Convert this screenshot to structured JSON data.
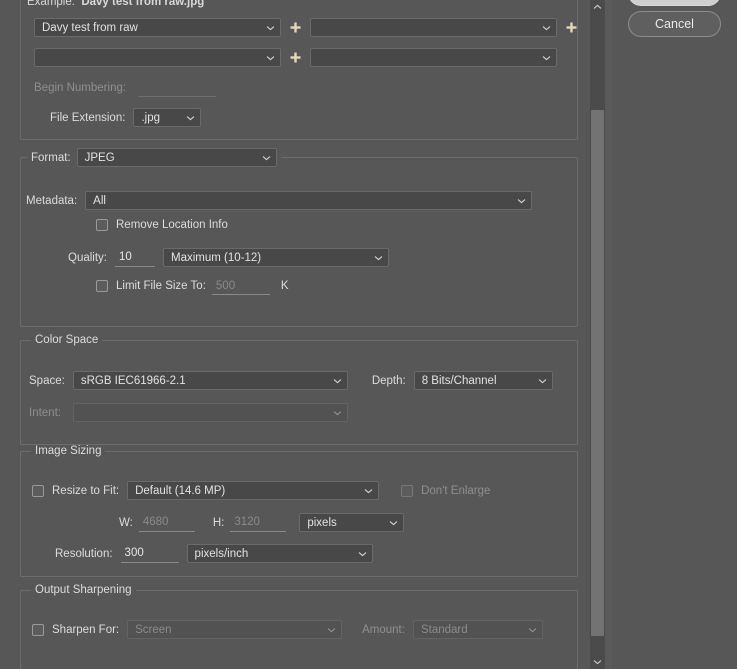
{
  "example": {
    "label": "Example:",
    "value": "Davy test from raw.jpg"
  },
  "file_naming": {
    "token_row1_left": "Davy test from raw",
    "token_row1_right": "",
    "token_row2_left": "",
    "token_row2_right": "",
    "begin_numbering_label": "Begin Numbering:",
    "begin_numbering_value": "",
    "file_extension_label": "File Extension:",
    "file_extension_value": ".jpg",
    "plus_icon": "plus-icon"
  },
  "format": {
    "label": "Format:",
    "value": "JPEG",
    "metadata_label": "Metadata:",
    "metadata_value": "All",
    "remove_location_label": "Remove Location Info",
    "remove_location_checked": false,
    "quality_label": "Quality:",
    "quality_value": "10",
    "quality_preset": "Maximum  (10-12)",
    "limit_file_size_label": "Limit File Size To:",
    "limit_file_size_checked": false,
    "limit_file_size_value": "500",
    "limit_file_size_unit": "K"
  },
  "color_space": {
    "title": "Color Space",
    "space_label": "Space:",
    "space_value": "sRGB IEC61966-2.1",
    "depth_label": "Depth:",
    "depth_value": "8 Bits/Channel",
    "intent_label": "Intent:",
    "intent_value": ""
  },
  "image_sizing": {
    "title": "Image Sizing",
    "resize_to_fit_label": "Resize to Fit:",
    "resize_to_fit_checked": false,
    "resize_to_fit_value": "Default  (14.6 MP)",
    "dont_enlarge_label": "Don't Enlarge",
    "dont_enlarge_checked": false,
    "w_label": "W:",
    "w_value": "4680",
    "h_label": "H:",
    "h_value": "3120",
    "units_value": "pixels",
    "resolution_label": "Resolution:",
    "resolution_value": "300",
    "resolution_units": "pixels/inch"
  },
  "output_sharpening": {
    "title": "Output Sharpening",
    "sharpen_for_label": "Sharpen For:",
    "sharpen_for_checked": false,
    "sharpen_for_value": "Screen",
    "amount_label": "Amount:",
    "amount_value": "Standard"
  },
  "buttons": {
    "primary_label": "",
    "cancel_label": "Cancel"
  },
  "scrollbar": {
    "up_icon": "chevron-up-icon",
    "down_icon": "chevron-down-icon"
  },
  "colors": {
    "window_bg": "#575757",
    "field_bg": "#484848",
    "border": "#6d6d6d",
    "text": "#dcdcdc",
    "text_dim": "#8f8f8f",
    "plus_accent": "#e8d6b8",
    "scrollbar_track": "#4b4b4b",
    "scrollbar_thumb": "#737373"
  }
}
